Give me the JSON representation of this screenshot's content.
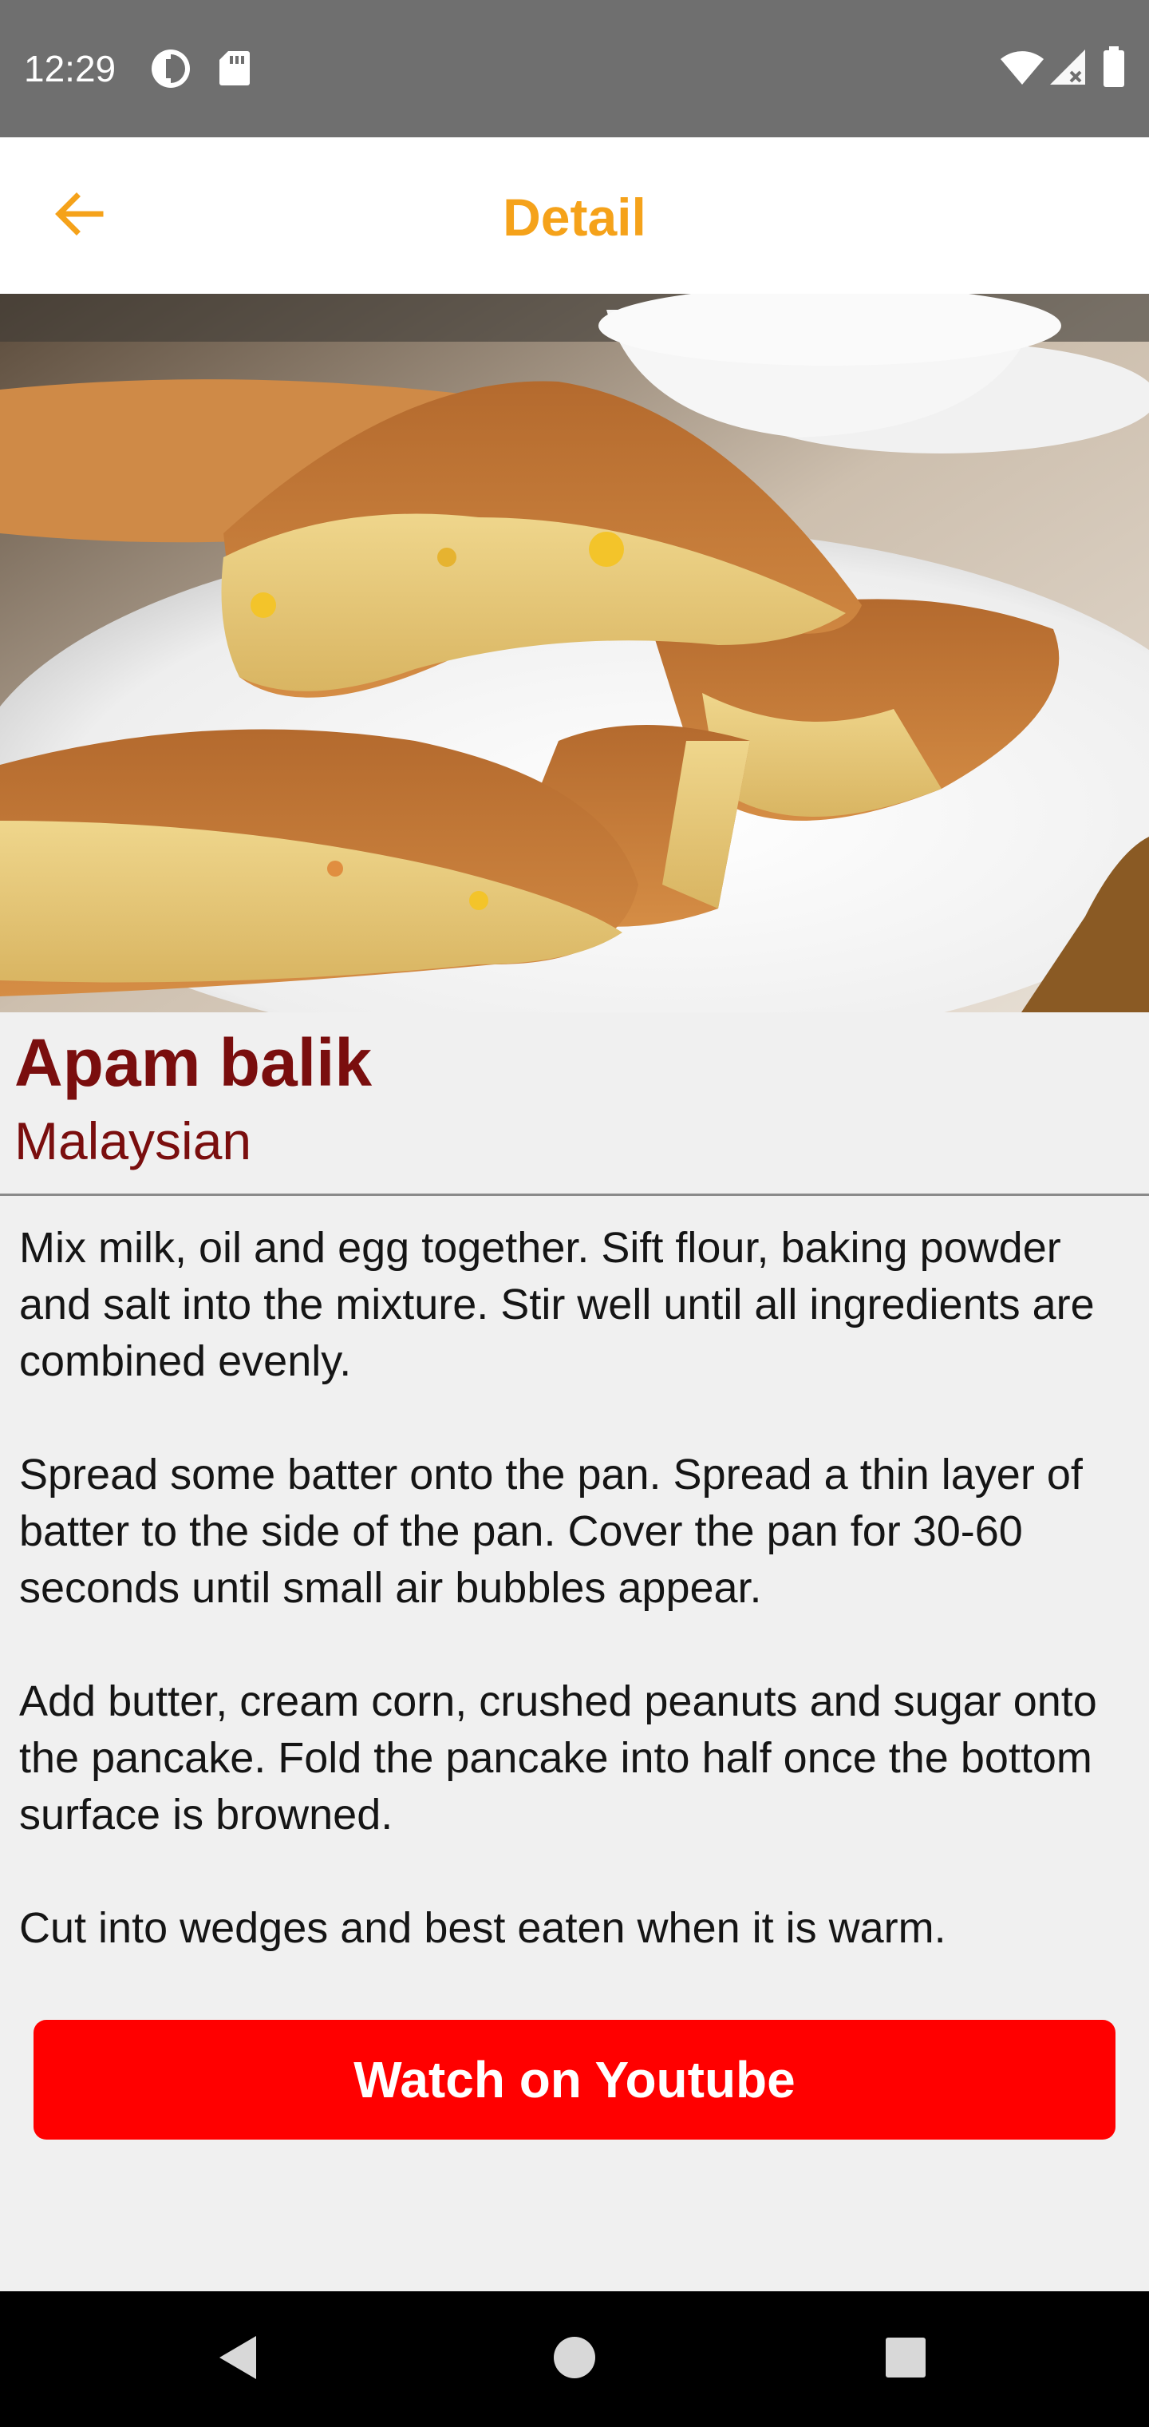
{
  "status_bar": {
    "time": "12:29",
    "icons": [
      "data-saver-icon",
      "sd-card-icon",
      "wifi-icon",
      "signal-icon",
      "battery-icon"
    ]
  },
  "app_bar": {
    "title": "Detail",
    "back_icon": "arrow-back-icon",
    "accent_color": "#f5a21a"
  },
  "recipe": {
    "name": "Apam balik",
    "area": "Malaysian",
    "title_color": "#7a0e0e",
    "instructions": "Mix milk, oil and egg together. Sift flour, baking powder and salt into the mixture. Stir well until all ingredients are combined evenly.\n\nSpread some batter onto the pan. Spread a thin layer of batter to the side of the pan. Cover the pan for 30-60 seconds until small air bubbles appear.\n\nAdd butter, cream corn, crushed peanuts and sugar onto the pancake. Fold the pancake into half once the bottom surface is browned.\n\nCut into wedges and best eaten when it is warm."
  },
  "youtube_button": {
    "label": "Watch on Youtube",
    "color": "#ff0000"
  },
  "nav_bar": {
    "icons": [
      "back-triangle-icon",
      "home-circle-icon",
      "recents-square-icon"
    ]
  }
}
